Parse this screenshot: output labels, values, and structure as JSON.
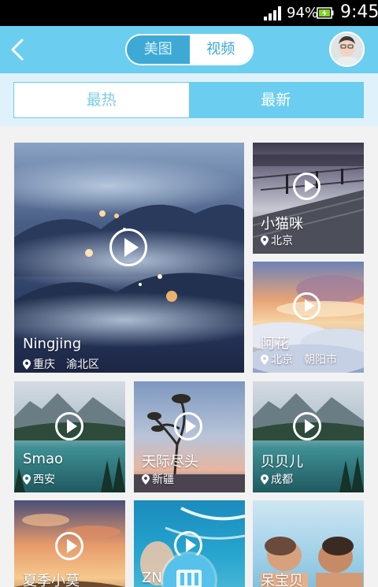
{
  "status_bar": {
    "battery_percent": "94%",
    "time": "9:45",
    "icons": [
      "signal-icon",
      "battery-icon"
    ]
  },
  "header": {
    "back_icon": "chevron-left-icon",
    "segment": {
      "photos_label": "美图",
      "videos_label": "视频",
      "selected": "视频"
    },
    "avatar_icon": "user-avatar"
  },
  "sort_tabs": {
    "hot_label": "最热",
    "new_label": "最新",
    "selected": "最新"
  },
  "videos": [
    {
      "name": "Ningjing",
      "location": "重庆　渝北区",
      "thumbnail": "misty-mountain-night"
    },
    {
      "name": "小猫咪",
      "location": "北京",
      "thumbnail": "pier-dusk"
    },
    {
      "name": "阿花",
      "location": "北京　朝阳市",
      "thumbnail": "clouds-sunset"
    },
    {
      "name": "Smao",
      "location": "西安",
      "thumbnail": "mountain-lake"
    },
    {
      "name": "天际尽头",
      "location": "新疆",
      "thumbnail": "tree-sunset"
    },
    {
      "name": "贝贝儿",
      "location": "成都",
      "thumbnail": "mountain-lake"
    },
    {
      "name": "夏季小莫",
      "location": "",
      "thumbnail": "sunset-field"
    },
    {
      "name": "ZN",
      "location": "",
      "thumbnail": "beach-waves"
    },
    {
      "name": "呆宝贝",
      "location": "",
      "thumbnail": "kids-sea"
    }
  ],
  "colors": {
    "accent": "#6bcdf0",
    "accent_dark": "#3fa9d6",
    "background": "#f2f2f2"
  },
  "fab_icon": "video-camera-icon"
}
